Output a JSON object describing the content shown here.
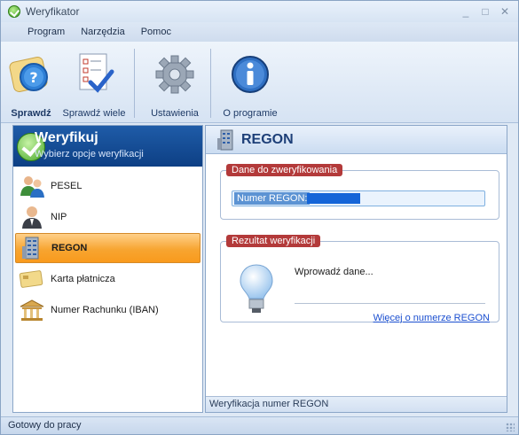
{
  "window": {
    "title": "Weryfikator"
  },
  "menu": {
    "items": [
      "Program",
      "Narzędzia",
      "Pomoc"
    ]
  },
  "toolbar": {
    "buttons": [
      {
        "label": "Sprawdź",
        "icon": "help-check-icon"
      },
      {
        "label": "Sprawdź wiele",
        "icon": "checklist-icon"
      },
      {
        "label": "Ustawienia",
        "icon": "gear-icon"
      },
      {
        "label": "O programie",
        "icon": "info-icon"
      }
    ]
  },
  "left": {
    "title": "Weryfikuj",
    "subtitle": "Wybierz opcje weryfikacji",
    "options": [
      {
        "label": "PESEL",
        "icon": "people-icon"
      },
      {
        "label": "NIP",
        "icon": "person-icon"
      },
      {
        "label": "REGON",
        "icon": "building-icon",
        "selected": true
      },
      {
        "label": "Karta płatnicza",
        "icon": "card-icon"
      },
      {
        "label": "Numer Rachunku (IBAN)",
        "icon": "bank-icon"
      }
    ]
  },
  "right": {
    "title": "REGON",
    "input_group": {
      "caption": "Dane do zweryfikowania",
      "field_label": "Numer REGON:",
      "field_value": ""
    },
    "result_group": {
      "caption": "Rezultat weryfikacji",
      "text": "Wprowadź dane...",
      "link": "Więcej o numerze REGON"
    },
    "footer": "Weryfikacja numer REGON"
  },
  "status": {
    "text": "Gotowy do pracy"
  },
  "colors": {
    "accent_selected": "#f7a531",
    "header_blue": "#1f5ca8",
    "tag_red": "#b33a3a"
  }
}
